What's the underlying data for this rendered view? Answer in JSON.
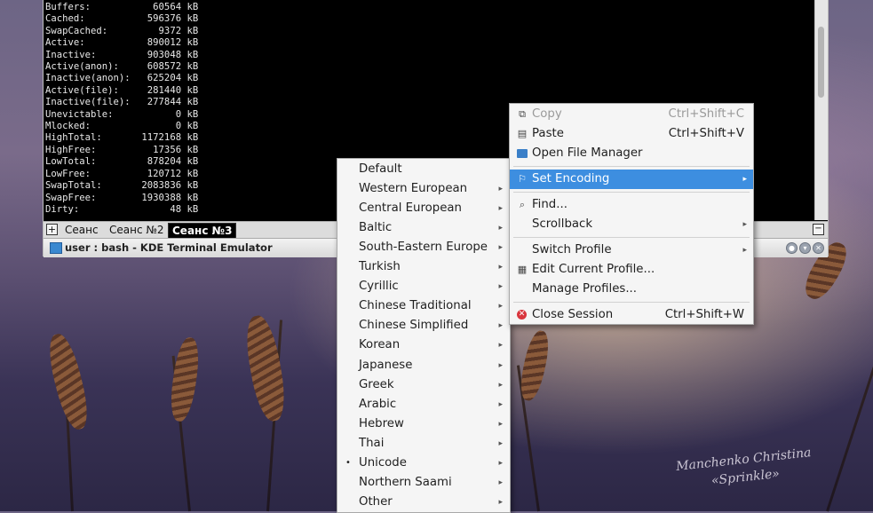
{
  "terminal": {
    "lines": [
      "Buffers:           60564 kB",
      "Cached:           596376 kB",
      "SwapCached:         9372 kB",
      "Active:           890012 kB",
      "Inactive:         903048 kB",
      "Active(anon):     608572 kB",
      "Inactive(anon):   625204 kB",
      "Active(file):     281440 kB",
      "Inactive(file):   277844 kB",
      "Unevictable:           0 kB",
      "Mlocked:               0 kB",
      "HighTotal:       1172168 kB",
      "HighFree:          17356 kB",
      "LowTotal:         878204 kB",
      "LowFree:          120712 kB",
      "SwapTotal:       2083836 kB",
      "SwapFree:        1930388 kB",
      "Dirty:                48 kB"
    ],
    "tabs": [
      "Сеанс",
      "Сеанс №2",
      "Сеанс №3"
    ],
    "new_tab_glyph": "+",
    "close_tab_glyph": "−",
    "window_title": "user : bash - KDE Terminal Emulator"
  },
  "context_menu": {
    "copy": {
      "label": "Copy",
      "shortcut": "Ctrl+Shift+C"
    },
    "paste": {
      "label": "Paste",
      "shortcut": "Ctrl+Shift+V"
    },
    "open_file_manager": {
      "label": "Open File Manager"
    },
    "set_encoding": {
      "label": "Set Encoding"
    },
    "find": {
      "label": "Find..."
    },
    "scrollback": {
      "label": "Scrollback"
    },
    "switch_profile": {
      "label": "Switch Profile"
    },
    "edit_profile": {
      "label": "Edit Current Profile..."
    },
    "manage_profiles": {
      "label": "Manage Profiles..."
    },
    "close_session": {
      "label": "Close Session",
      "shortcut": "Ctrl+Shift+W"
    }
  },
  "encoding_menu": {
    "items": [
      "Default",
      "Western European",
      "Central European",
      "Baltic",
      "South-Eastern Europe",
      "Turkish",
      "Cyrillic",
      "Chinese Traditional",
      "Chinese Simplified",
      "Korean",
      "Japanese",
      "Greek",
      "Arabic",
      "Hebrew",
      "Thai",
      "Unicode",
      "Northern Saami",
      "Other"
    ],
    "selected": "Unicode"
  },
  "colors": {
    "highlight": "#3d8ee0",
    "menu_bg": "#f5f5f5",
    "terminal_bg": "#000000"
  }
}
